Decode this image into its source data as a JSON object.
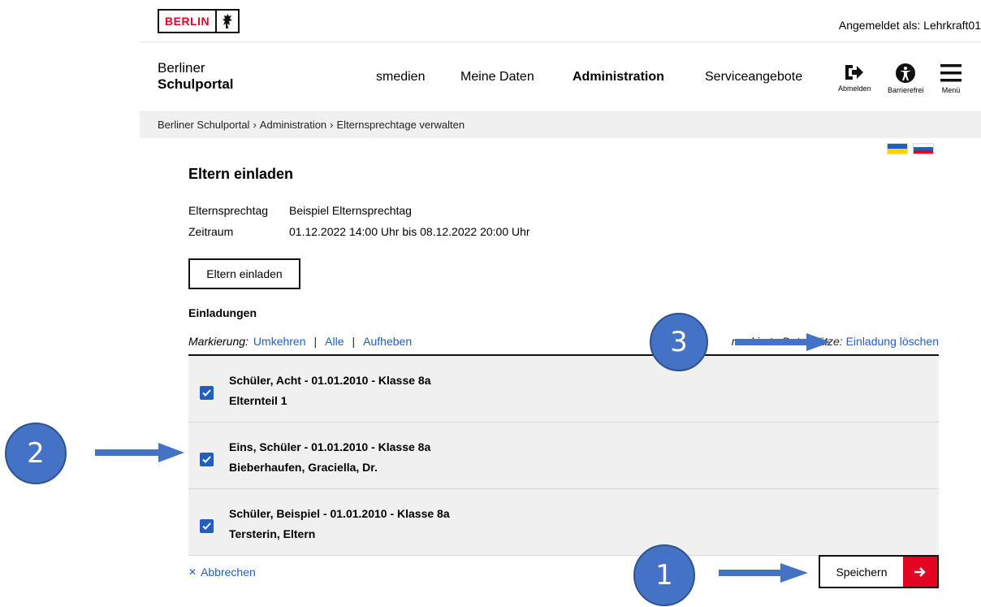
{
  "header": {
    "logo_text": "BERLIN",
    "logged_in": "Angemeldet als: Lehrkraft01",
    "brand_line1": "Berliner",
    "brand_line2": "Schulportal"
  },
  "nav": {
    "items": [
      {
        "label": "smedien",
        "active": false
      },
      {
        "label": "Meine Daten",
        "active": false
      },
      {
        "label": "Administration",
        "active": true
      },
      {
        "label": "Serviceangebote",
        "active": false
      }
    ],
    "icons": [
      {
        "label": "Abmelden",
        "icon": "logout-icon"
      },
      {
        "label": "Barrierefrei",
        "icon": "accessibility-icon"
      },
      {
        "label": "Menü",
        "icon": "menu-icon"
      }
    ]
  },
  "breadcrumb": [
    "Berliner Schulportal",
    "Administration",
    "Elternsprechtage verwalten"
  ],
  "page": {
    "title": "Eltern einladen",
    "meta": [
      {
        "key": "Elternsprechtag",
        "value": "Beispiel Elternsprechtag"
      },
      {
        "key": "Zeitraum",
        "value": "01.12.2022 14:00 Uhr bis 08.12.2022 20:00 Uhr"
      }
    ],
    "invite_button": "Eltern einladen",
    "section_title": "Einladungen"
  },
  "marking": {
    "label": "Markierung:",
    "links": [
      "Umkehren",
      "Alle",
      "Aufheben"
    ],
    "action_label": "markierte Datensätze:",
    "action_link": "Einladung löschen"
  },
  "invitations": [
    {
      "student": "Schüler, Acht - 01.01.2010 - Klasse 8a",
      "parent": "Elternteil 1",
      "checked": true
    },
    {
      "student": "Eins, Schüler - 01.01.2010 - Klasse 8a",
      "parent": "Bieberhaufen, Graciella, Dr.",
      "checked": true
    },
    {
      "student": "Schüler, Beispiel - 01.01.2010 - Klasse 8a",
      "parent": "Tersterin, Eltern",
      "checked": true
    }
  ],
  "footer": {
    "cancel": "Abbrechen",
    "save": "Speichern"
  },
  "annotations": {
    "markers": [
      "1",
      "2",
      "3"
    ],
    "color": "#4472c4"
  },
  "colors": {
    "brand_red": "#e40421",
    "link_blue": "#1f5fbf"
  }
}
